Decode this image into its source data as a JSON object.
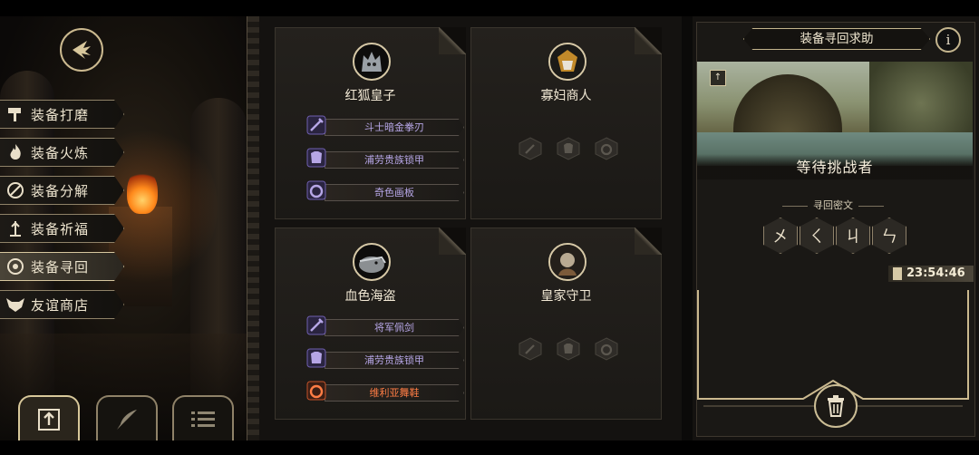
{
  "left_menu": {
    "items": [
      {
        "label": "装备打磨",
        "icon": "hammer-icon"
      },
      {
        "label": "装备火炼",
        "icon": "flame-icon"
      },
      {
        "label": "装备分解",
        "icon": "disassemble-icon"
      },
      {
        "label": "装备祈福",
        "icon": "pray-icon"
      },
      {
        "label": "装备寻回",
        "icon": "retrieve-icon",
        "active": true
      },
      {
        "label": "友谊商店",
        "icon": "fox-shop-icon"
      }
    ]
  },
  "bottom_tabs": [
    {
      "icon": "upload-icon",
      "active": true
    },
    {
      "icon": "feather-icon"
    },
    {
      "icon": "list-icon"
    }
  ],
  "cards": [
    {
      "name": "红狐皇子",
      "portrait": "red-fox-prince-portrait",
      "slots": [
        {
          "icon": "sword-icon",
          "label": "斗士暗金拳刃",
          "color": "#b6a6e6"
        },
        {
          "icon": "armor-icon",
          "label": "浦劳贵族锁甲",
          "color": "#b6a6e6"
        },
        {
          "icon": "ring-icon",
          "label": "奇色画板",
          "color": "#b6a6e6"
        }
      ]
    },
    {
      "name": "寡妇商人",
      "portrait": "widow-merchant-portrait",
      "empty": true
    },
    {
      "name": "血色海盗",
      "portrait": "crimson-pirate-portrait",
      "slots": [
        {
          "icon": "sword-icon",
          "label": "将军佩剑",
          "color": "#b6a6e6"
        },
        {
          "icon": "armor-icon",
          "label": "浦劳贵族锁甲",
          "color": "#b6a6e6"
        },
        {
          "icon": "ring-icon",
          "label": "维利亚舞鞋",
          "color": "#ff7d45"
        }
      ]
    },
    {
      "name": "皇家守卫",
      "portrait": "royal-guard-portrait",
      "empty": true
    }
  ],
  "right_panel": {
    "title": "装备寻回求助",
    "status": "等待挑战者",
    "cipher_label": "寻回密文",
    "runes": [
      "㐅",
      "ㄑ",
      "ㄐ",
      "ㄣ"
    ],
    "timer": "23:54:46"
  },
  "colors": {
    "gold": "#cbb98f",
    "epic": "#b6a6e6",
    "legendary": "#ff7d45"
  }
}
